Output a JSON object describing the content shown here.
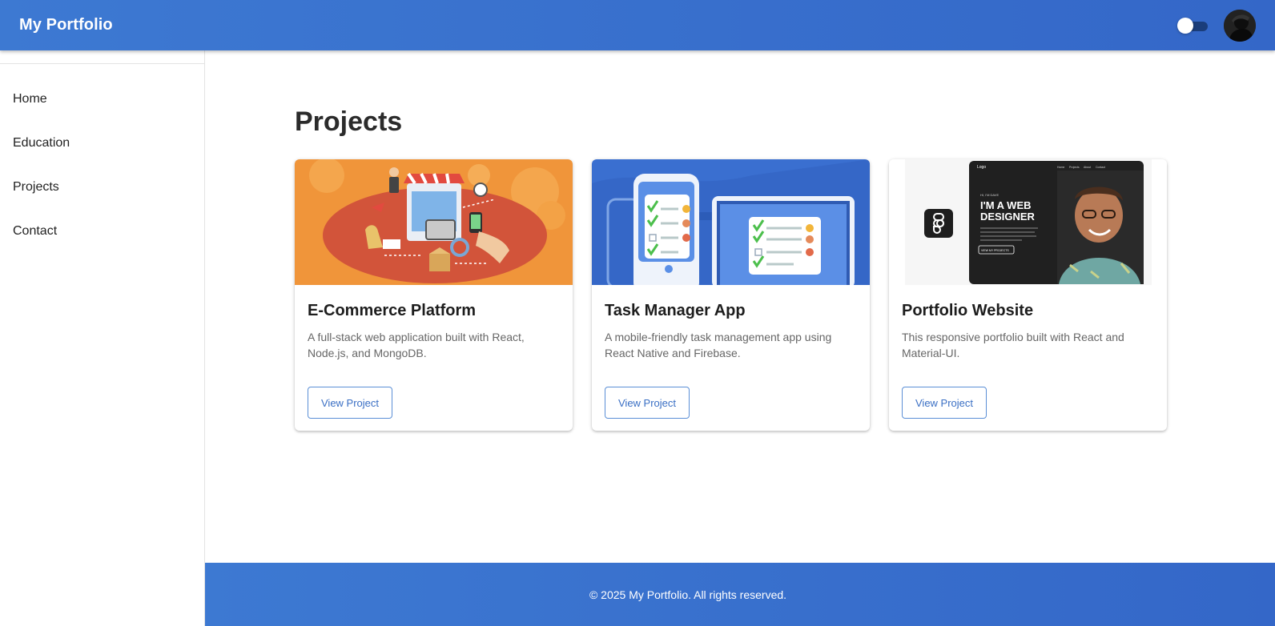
{
  "header": {
    "brand": "My Portfolio",
    "theme_toggle": {
      "checked": false,
      "icon": "toggle-switch"
    },
    "avatar": {
      "icon": "user-avatar"
    }
  },
  "sidebar": {
    "items": [
      {
        "label": "Home"
      },
      {
        "label": "Education"
      },
      {
        "label": "Projects"
      },
      {
        "label": "Contact"
      }
    ]
  },
  "main": {
    "title": "Projects",
    "projects": [
      {
        "title": "E-Commerce Platform",
        "description": "A full-stack web application built with React, Node.js, and MongoDB.",
        "button": "View Project"
      },
      {
        "title": "Task Manager App",
        "description": "A mobile-friendly task management app using React Native and Firebase.",
        "button": "View Project"
      },
      {
        "title": "Portfolio Website",
        "description": "This responsive portfolio built with React and Material-UI.",
        "button": "View Project",
        "preview": {
          "logo": "Logo",
          "nav": [
            "Home",
            "Projects",
            "About",
            "Contact"
          ],
          "eyebrow": "HI, I'M DAVE",
          "heading_line1": "I'M A WEB",
          "heading_line2": "DESIGNER",
          "cta": "VIEW MY PROJECTS"
        }
      }
    ]
  },
  "footer": {
    "text": "© 2025 My Portfolio. All rights reserved."
  },
  "colors": {
    "primary": "#3a72cf",
    "button_outline": "#5b8fd6",
    "button_text": "#3a6fc4"
  }
}
